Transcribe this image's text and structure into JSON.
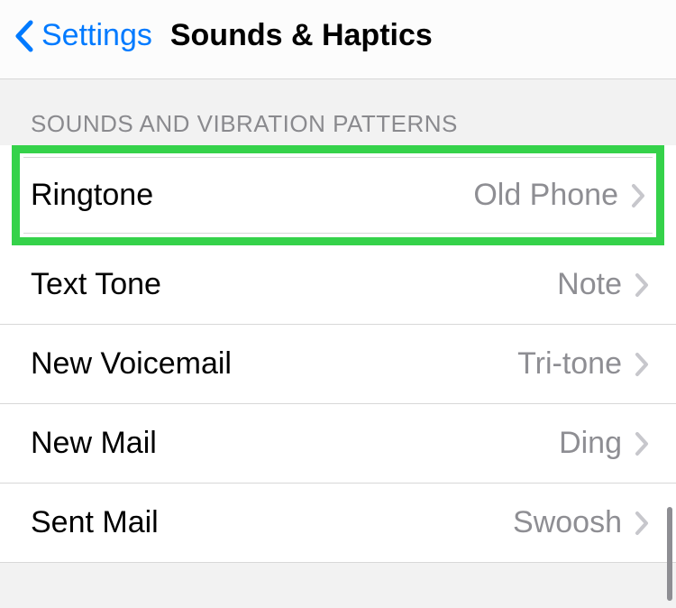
{
  "header": {
    "back_label": "Settings",
    "title": "Sounds & Haptics"
  },
  "section": {
    "header": "SOUNDS AND VIBRATION PATTERNS"
  },
  "items": [
    {
      "label": "Ringtone",
      "value": "Old Phone"
    },
    {
      "label": "Text Tone",
      "value": "Note"
    },
    {
      "label": "New Voicemail",
      "value": "Tri-tone"
    },
    {
      "label": "New Mail",
      "value": "Ding"
    },
    {
      "label": "Sent Mail",
      "value": "Swoosh"
    }
  ]
}
